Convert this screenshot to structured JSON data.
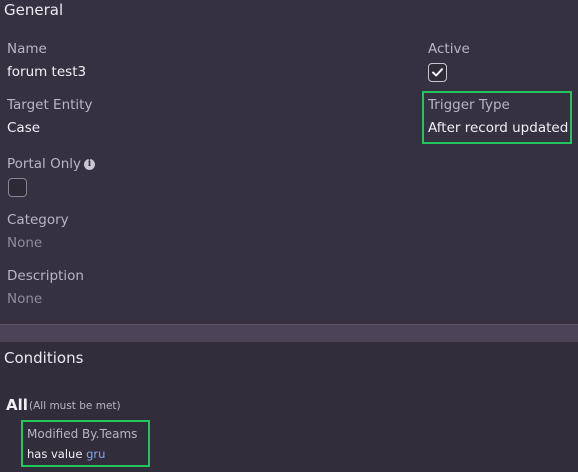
{
  "general": {
    "title": "General",
    "name": {
      "label": "Name",
      "value": "forum test3"
    },
    "active": {
      "label": "Active",
      "checked": true
    },
    "target_entity": {
      "label": "Target Entity",
      "value": "Case"
    },
    "trigger_type": {
      "label": "Trigger Type",
      "value": "After record updated"
    },
    "portal_only": {
      "label": "Portal Only",
      "checked": false
    },
    "category": {
      "label": "Category",
      "value": "None"
    },
    "description": {
      "label": "Description",
      "value": "None"
    }
  },
  "conditions": {
    "title": "Conditions",
    "group_label": "All",
    "group_note": "(All must be met)",
    "items": [
      {
        "field": "Modified By.Teams",
        "operator": "has value",
        "value": "gru"
      }
    ]
  },
  "colors": {
    "highlight": "#22c55e",
    "link": "#7fa4e8"
  }
}
